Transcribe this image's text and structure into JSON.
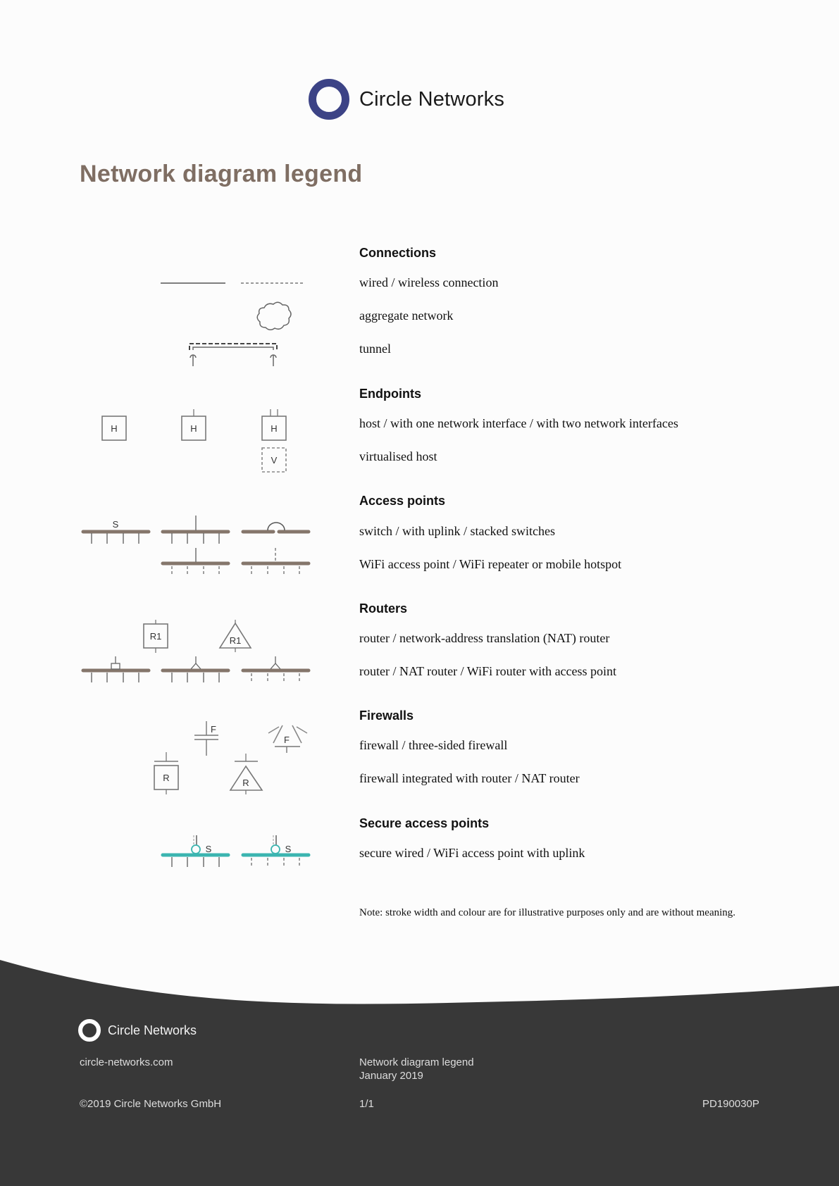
{
  "header": {
    "brand": "Circle Networks",
    "logo_icon": "circle-ring-logo",
    "accent_color": "#3c4386"
  },
  "title": "Network diagram legend",
  "title_color": "#7f6e63",
  "sections": [
    {
      "heading": "Connections",
      "items": [
        "wired / wireless connection",
        "aggregate network",
        "tunnel"
      ]
    },
    {
      "heading": "Endpoints",
      "items": [
        "host / with one network interface / with two network interfaces",
        "virtualised host"
      ]
    },
    {
      "heading": "Access points",
      "items": [
        "switch / with uplink / stacked switches",
        "WiFi access point / WiFi repeater or mobile hotspot"
      ]
    },
    {
      "heading": "Routers",
      "items": [
        "router / network-address translation (NAT) router",
        "router / NAT router / WiFi router with access point"
      ]
    },
    {
      "heading": "Firewalls",
      "items": [
        "firewall / three-sided firewall",
        "firewall integrated with router / NAT router"
      ]
    },
    {
      "heading": "Secure access points",
      "items": [
        "secure wired / WiFi access point with uplink"
      ]
    }
  ],
  "symbol_labels": {
    "host": "H",
    "virtual_host": "V",
    "switch": "S",
    "router": "R1",
    "firewall": "F",
    "firewall_router": "R",
    "secure_switch": "S"
  },
  "colors": {
    "switch": "#85766b",
    "secure": "#3bb5b0",
    "line": "#666666"
  },
  "note": "Note: stroke width and colour are for illustrative purposes only and are without meaning.",
  "footer": {
    "brand": "Circle Networks",
    "website": "circle-networks.com",
    "doc_title": "Network diagram legend",
    "doc_date": "January 2019",
    "copyright": "©2019 Circle Networks GmbH",
    "page": "1/1",
    "doc_code": "PD190030P",
    "background": "#383838"
  }
}
